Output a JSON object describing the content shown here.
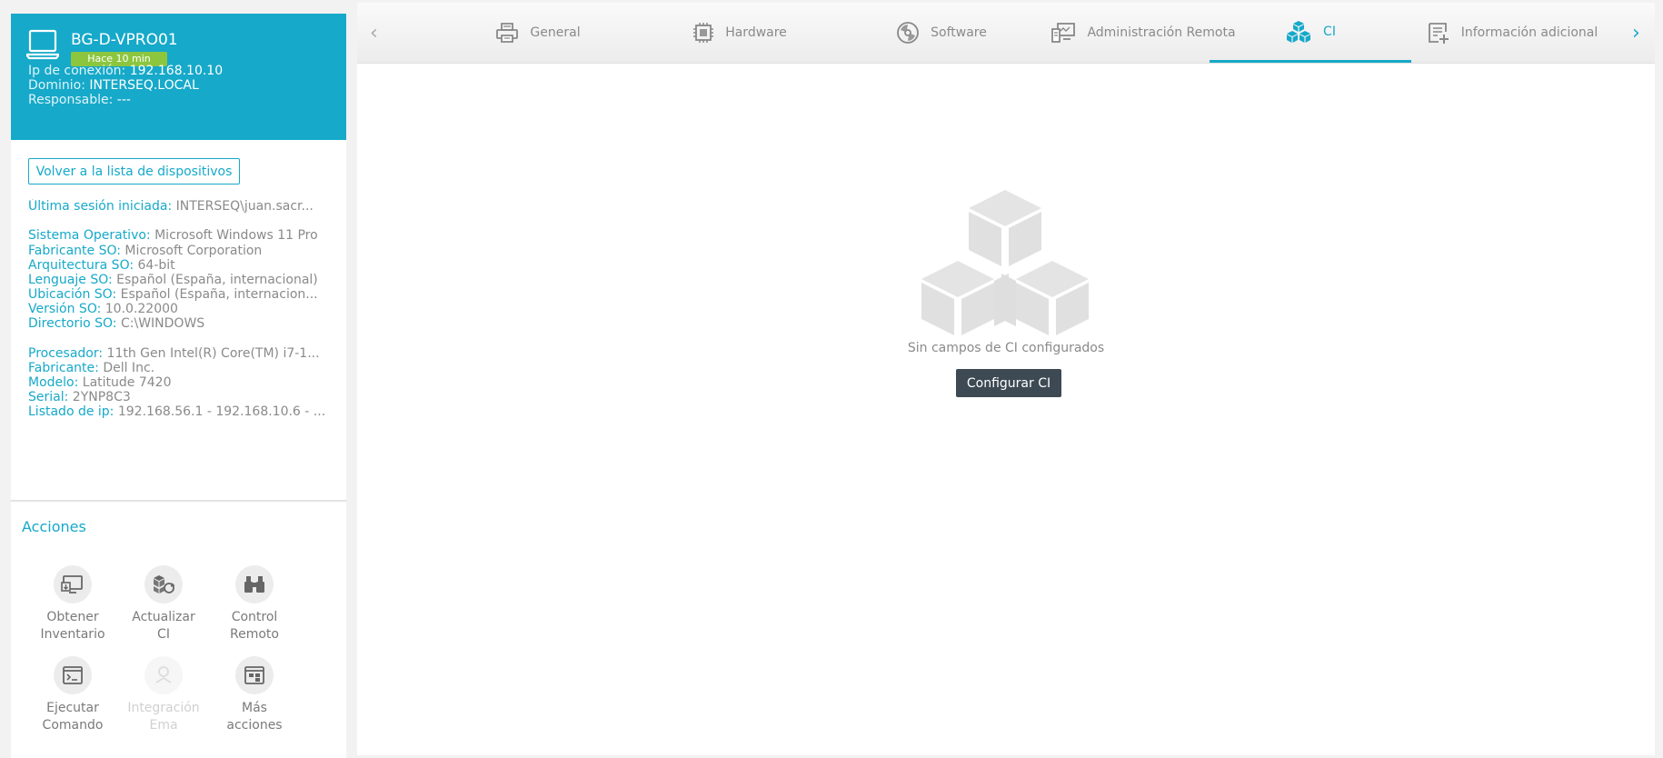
{
  "device": {
    "name": "BG-D-VPRO01",
    "last_seen": "Hace 10 min",
    "ip_label": "Ip de conexión:",
    "ip_value": "192.168.10.10",
    "domain_label": "Dominio:",
    "domain_value": "INTERSEQ.LOCAL",
    "owner_label": "Responsable:",
    "owner_value": "---"
  },
  "back_button": "Volver a la lista de dispositivos",
  "info": {
    "session": {
      "label": "Última sesión iniciada:",
      "value": "INTERSEQ\\juan.sacr..."
    },
    "os": [
      {
        "label": "Sistema Operativo:",
        "value": "Microsoft Windows 11 Pro"
      },
      {
        "label": "Fabricante SO:",
        "value": "Microsoft Corporation"
      },
      {
        "label": "Arquitectura SO:",
        "value": "64-bit"
      },
      {
        "label": "Lenguaje SO:",
        "value": "Español (España, internacional)"
      },
      {
        "label": "Ubicación SO:",
        "value": "Español (España, internacion..."
      },
      {
        "label": "Versión SO:",
        "value": "10.0.22000"
      },
      {
        "label": "Directorio SO:",
        "value": "C:\\WINDOWS"
      }
    ],
    "hw": [
      {
        "label": "Procesador:",
        "value": "11th Gen Intel(R) Core(TM) i7-1..."
      },
      {
        "label": "Fabricante:",
        "value": "Dell Inc."
      },
      {
        "label": "Modelo:",
        "value": "Latitude 7420"
      },
      {
        "label": "Serial:",
        "value": "2YNP8C3"
      },
      {
        "label": "Listado de ip:",
        "value": "192.168.56.1 - 192.168.10.6 - ..."
      }
    ]
  },
  "actions": {
    "title": "Acciones",
    "items": [
      {
        "line1": "Obtener",
        "line2": "Inventario",
        "icon": "inventory-icon"
      },
      {
        "line1": "Actualizar",
        "line2": "CI",
        "icon": "update-ci-icon"
      },
      {
        "line1": "Control",
        "line2": "Remoto",
        "icon": "binoculars-icon"
      },
      {
        "line1": "Ejecutar",
        "line2": "Comando",
        "icon": "terminal-icon"
      },
      {
        "line1": "Integración",
        "line2": "Ema",
        "icon": "integration-icon"
      },
      {
        "line1": "Más",
        "line2": "acciones",
        "icon": "more-actions-icon"
      }
    ]
  },
  "tabs": [
    {
      "label": "General",
      "icon": "printer-icon"
    },
    {
      "label": "Hardware",
      "icon": "chip-icon"
    },
    {
      "label": "Software",
      "icon": "disc-icon"
    },
    {
      "label": "Administración Remota",
      "icon": "remote-admin-icon"
    },
    {
      "label": "CI",
      "icon": "cubes-icon"
    },
    {
      "label": "Información adicional",
      "icon": "add-info-icon"
    }
  ],
  "empty_state": {
    "message": "Sin campos de CI configurados",
    "button": "Configurar CI"
  },
  "colors": {
    "accent": "#16a9c9",
    "badge": "#8cc63f",
    "button_dark": "#3d4a54"
  }
}
